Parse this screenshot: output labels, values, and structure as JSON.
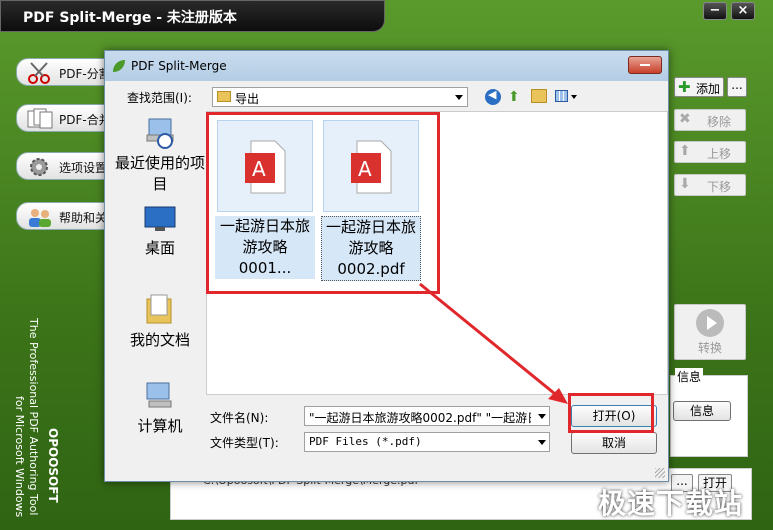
{
  "app": {
    "title": "PDF Split-Merge - 未注册版本",
    "nav": [
      {
        "label": "PDF-分割"
      },
      {
        "label": "PDF-合并"
      },
      {
        "label": "选项设置"
      },
      {
        "label": "帮助和关"
      }
    ],
    "vertical_text": [
      "OPOOSOFT",
      "The Professional PDF Authoring Tool",
      "for Microsoft Windows"
    ],
    "right_buttons": {
      "add": "添加",
      "more": "...",
      "remove": "移除",
      "up": "上移",
      "down": "下移",
      "convert": "转换",
      "info_group": "信息",
      "info_button": "信息",
      "open_button": "打开",
      "browse": "..."
    },
    "output_path": "C:\\Opoosoft\\PDF Split-Merge\\Merge.pdf",
    "minimize": "−",
    "close": "×"
  },
  "dialog": {
    "title": "PDF Split-Merge",
    "lookin_label": "查找范围(I):",
    "lookin_value": "导出",
    "places": [
      {
        "label": "最近使用的项目"
      },
      {
        "label": "桌面"
      },
      {
        "label": "我的文档"
      },
      {
        "label": "计算机"
      }
    ],
    "files": [
      {
        "name": "一起游日本旅游攻略0001..."
      },
      {
        "name": "一起游日本旅游攻略0002.pdf"
      }
    ],
    "filename_label": "文件名(N):",
    "filename_value": "\"一起游日本旅游攻略0002.pdf\" \"一起游日",
    "filetype_label": "文件类型(T):",
    "filetype_value": "PDF Files (*.pdf)",
    "open_button": "打开(O)",
    "cancel_button": "取消"
  },
  "watermark": "极速下载站",
  "colors": {
    "highlight_red": "#e0272c",
    "app_green": "#3c7419"
  }
}
